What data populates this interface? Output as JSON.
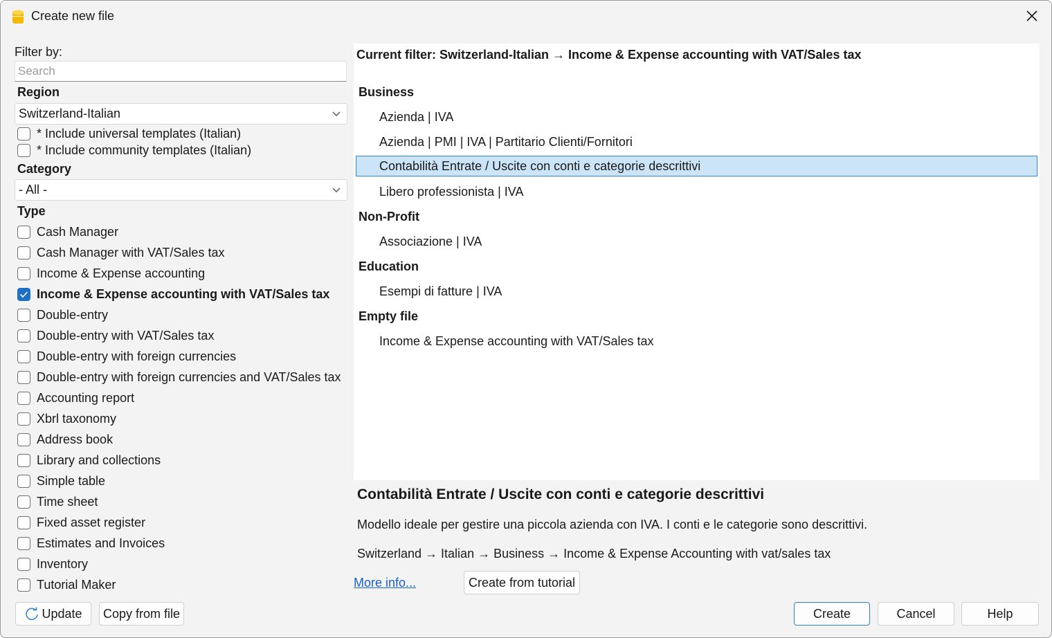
{
  "window": {
    "title": "Create new file"
  },
  "filter": {
    "label": "Filter by:",
    "search_placeholder": "Search",
    "search_value": ""
  },
  "region": {
    "label": "Region",
    "selected": "Switzerland-Italian",
    "include_universal": "* Include universal templates (Italian)",
    "include_community": "* Include community templates (Italian)"
  },
  "category": {
    "label": "Category",
    "selected": "- All -"
  },
  "type": {
    "label": "Type",
    "items": [
      {
        "label": "Cash Manager",
        "checked": false
      },
      {
        "label": "Cash Manager with VAT/Sales tax",
        "checked": false
      },
      {
        "label": "Income & Expense accounting",
        "checked": false
      },
      {
        "label": "Income & Expense accounting with VAT/Sales tax",
        "checked": true
      },
      {
        "label": "Double-entry",
        "checked": false
      },
      {
        "label": "Double-entry with VAT/Sales tax",
        "checked": false
      },
      {
        "label": "Double-entry with foreign currencies",
        "checked": false
      },
      {
        "label": "Double-entry with foreign currencies and VAT/Sales tax",
        "checked": false
      },
      {
        "label": "Accounting report",
        "checked": false
      },
      {
        "label": "Xbrl taxonomy",
        "checked": false
      },
      {
        "label": "Address book",
        "checked": false
      },
      {
        "label": "Library and collections",
        "checked": false
      },
      {
        "label": "Simple table",
        "checked": false
      },
      {
        "label": "Time sheet",
        "checked": false
      },
      {
        "label": "Fixed asset register",
        "checked": false
      },
      {
        "label": "Estimates and Invoices",
        "checked": false
      },
      {
        "label": "Inventory",
        "checked": false
      },
      {
        "label": "Tutorial Maker",
        "checked": false
      }
    ]
  },
  "templates": {
    "current_filter": "Current filter: Switzerland-Italian → Income & Expense accounting with VAT/Sales tax",
    "groups": [
      {
        "title": "Business",
        "items": [
          "Azienda | IVA",
          "Azienda | PMI | IVA | Partitario Clienti/Fornitori",
          "Contabilità Entrate / Uscite con conti e categorie descrittivi",
          "Libero professionista | IVA"
        ]
      },
      {
        "title": "Non-Profit",
        "items": [
          "Associazione | IVA"
        ]
      },
      {
        "title": "Education",
        "items": [
          "Esempi di fatture | IVA"
        ]
      },
      {
        "title": "Empty file",
        "items": [
          "Income & Expense accounting with VAT/Sales tax"
        ]
      }
    ],
    "selected": "Contabilità Entrate / Uscite con conti e categorie descrittivi"
  },
  "description": {
    "title": "Contabilità Entrate / Uscite con conti e categorie descrittivi",
    "text": "Modello ideale per gestire una piccola azienda con IVA. I conti e le categorie sono descrittivi.",
    "path": "Switzerland → Italian → Business → Income & Expense Accounting with vat/sales tax",
    "more_info": "More info..."
  },
  "buttons": {
    "create_from_tutorial": "Create from tutorial",
    "update": "Update",
    "copy_from_file": "Copy from file",
    "create": "Create",
    "cancel": "Cancel",
    "help": "Help"
  },
  "colors": {
    "accent": "#1f6fc6",
    "selection_bg": "#cce4f7",
    "selection_border": "#2a8ad6",
    "link": "#1a5fc8",
    "app_icon": "#f5b800"
  }
}
